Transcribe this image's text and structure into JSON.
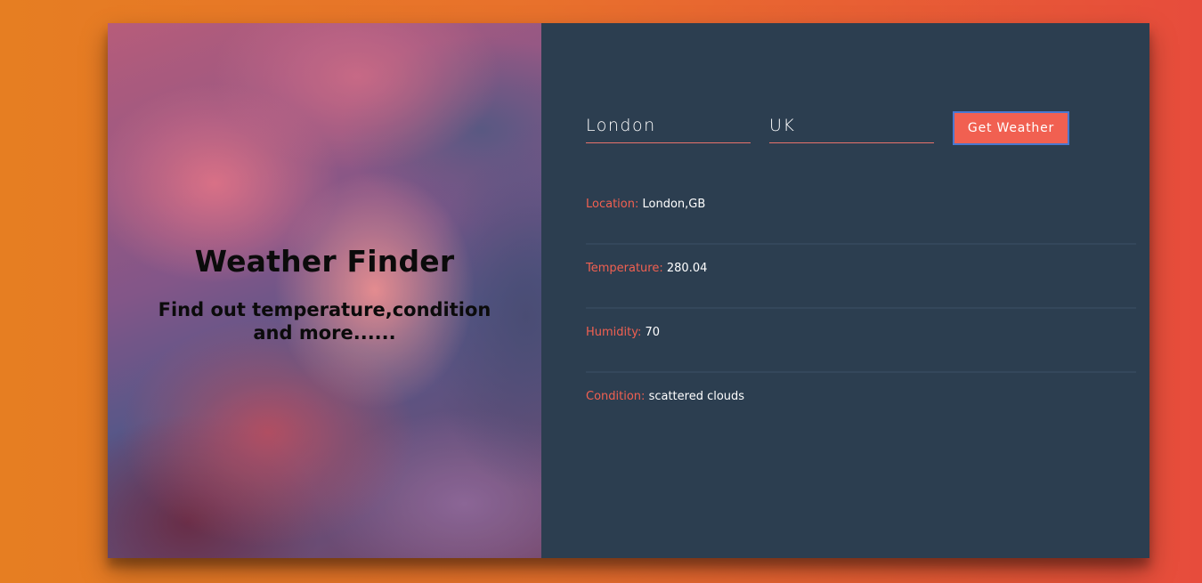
{
  "title_panel": {
    "heading": "Weather Finder",
    "subheading": "Find out temperature,condition and more......"
  },
  "form": {
    "city_value": "London",
    "country_value": "UK",
    "button_label": "Get Weather",
    "button_color": "#f16051"
  },
  "weather": {
    "location_label": "Location:",
    "location_value": "London,GB",
    "temperature_label": "Temperature:",
    "temperature_value": "280.04",
    "humidity_label": "Humidity:",
    "humidity_value": "70",
    "condition_label": "Condition:",
    "condition_value": "scattered clouds"
  },
  "colors": {
    "panel_bg": "#2c3e50",
    "accent": "#f16051",
    "page_gradient_start": "#e67e22",
    "page_gradient_end": "#e74c3c"
  }
}
